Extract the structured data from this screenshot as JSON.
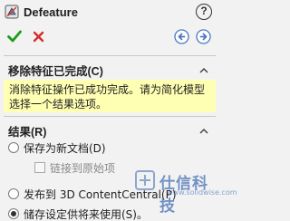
{
  "header": {
    "title": "Defeature",
    "help_label": "?"
  },
  "message_section": {
    "title": "移除特征已完成(C)",
    "message": "消除特征操作已成功完成。请为简化模型选择一个结果选项。"
  },
  "results_section": {
    "title": "结果(R)",
    "options": [
      {
        "label": "保存为新文档(D)",
        "selected": false
      },
      {
        "label": "链接到原始项",
        "checkbox": true,
        "enabled": false
      },
      {
        "label": "发布到 3D ContentCentral(P)",
        "selected": false
      },
      {
        "label": "储存设定供将来使用(S)。",
        "selected": true
      }
    ]
  },
  "watermark": {
    "text": "仕信科技",
    "url": "www.solidwise.com"
  },
  "colors": {
    "ok_green": "#1a9c1a",
    "cancel_red": "#d42a2a",
    "message_bg": "#ffffb3",
    "nav_blue": "#4a78c0"
  },
  "icons": {
    "ok": "checkmark-icon",
    "cancel": "x-icon",
    "back": "arrow-left-icon",
    "forward": "arrow-right-icon",
    "help": "help-icon",
    "collapse": "chevron-up-icon"
  }
}
